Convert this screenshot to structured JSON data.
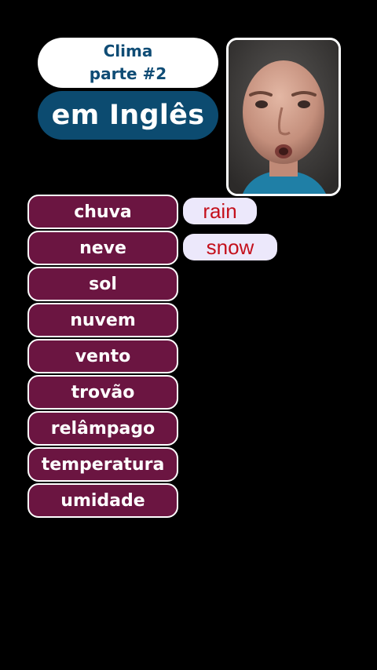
{
  "header": {
    "title_line1": "Clima",
    "title_line2": "parte #2",
    "subtitle": "em Inglês"
  },
  "video": {
    "icon": "person-face-video"
  },
  "words": [
    {
      "pt": "chuva",
      "en": "rain"
    },
    {
      "pt": "neve",
      "en": "snow"
    },
    {
      "pt": "sol",
      "en": ""
    },
    {
      "pt": "nuvem",
      "en": ""
    },
    {
      "pt": "vento",
      "en": ""
    },
    {
      "pt": "trovão",
      "en": ""
    },
    {
      "pt": "relâmpago",
      "en": ""
    },
    {
      "pt": "temperatura",
      "en": ""
    },
    {
      "pt": "umidade",
      "en": ""
    }
  ],
  "colors": {
    "background": "#000000",
    "title_text": "#0f4c75",
    "subtitle_bg": "#0c4b70",
    "word_bg": "#6b1541",
    "answer_bg": "#ece8fb",
    "answer_text": "#c4101c"
  }
}
